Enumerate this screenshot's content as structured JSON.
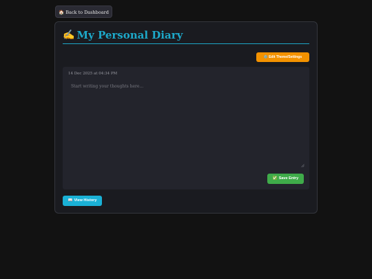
{
  "nav": {
    "back_icon": "house-icon",
    "back_glyph": "🏠",
    "back_label": "Back to Dashboard"
  },
  "diary": {
    "title_icon": "writing-hand-icon",
    "title_glyph": "✍️",
    "title": "My Personal Diary",
    "theme_button_icon": "gear-icon",
    "theme_button_glyph": "⚙️",
    "theme_button_label": "Edit Theme/Settings",
    "timestamp": "14 Dec 2025 at 04:34 PM",
    "entry_value": "",
    "entry_placeholder": "Start writing your thoughts here...",
    "save_button_icon": "checkmark-icon",
    "save_button_glyph": "✅",
    "save_button_label": "Save Entry",
    "history_button_icon": "book-icon",
    "history_button_glyph": "📖",
    "history_button_label": "View History"
  },
  "colors": {
    "page_background": "#121212",
    "card_background": "#1a1b20",
    "editor_background": "#23242c",
    "accent_cyan": "#1da8c9",
    "theme_button_orange": "#f39200",
    "save_button_green": "#3fab4a",
    "history_button_blue": "#1ab1d6"
  }
}
